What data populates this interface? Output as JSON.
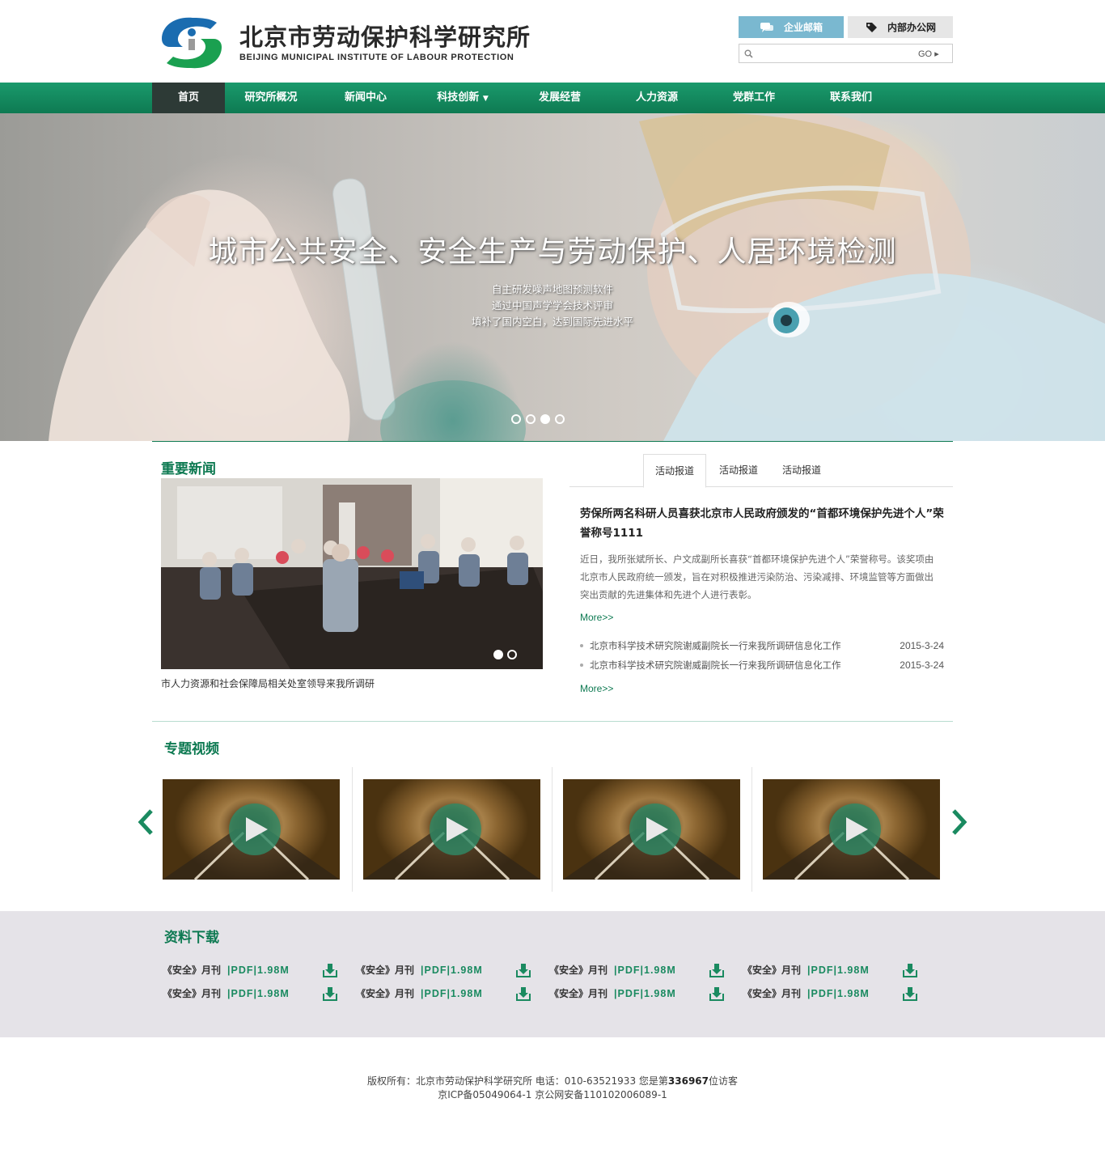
{
  "header": {
    "logo_cn": "北京市劳动保护科学研究所",
    "logo_en": "BEIJING MUNICIPAL INSTITUTE OF LABOUR PROTECTION",
    "mail_label": "企业邮箱",
    "office_label": "内部办公网",
    "search_placeholder": "",
    "search_go": "GO"
  },
  "nav": {
    "items": [
      {
        "label": "首页"
      },
      {
        "label": "研究所概况"
      },
      {
        "label": "新闻中心"
      },
      {
        "label": "科技创新"
      },
      {
        "label": "发展经营"
      },
      {
        "label": "人力资源"
      },
      {
        "label": "党群工作"
      },
      {
        "label": "联系我们"
      }
    ]
  },
  "banner": {
    "title": "城市公共安全、安全生产与劳动保护、人居环境检测",
    "lines": [
      "自主研发噪声地图预测软件",
      "通过中国声学学会技术评审",
      "填补了国内空白，达到国际先进水平"
    ],
    "active_slide": 3,
    "slide_count": 4
  },
  "news": {
    "title": "重要新闻",
    "photo_caption": "市人力资源和社会保障局相关处室领导来我所调研",
    "tabs": [
      {
        "label": "活动报道"
      },
      {
        "label": "活动报道"
      },
      {
        "label": "活动报道"
      }
    ],
    "headline": "劳保所两名科研人员喜获北京市人民政府颁发的“首都环境保护先进个人”荣誉称号1111",
    "summary": "近日，我所张斌所长、户文成副所长喜获“首都环境保护先进个人”荣誉称号。该奖项由北京市人民政府统一颁发，旨在对积极推进污染防治、污染减排、环境监管等方面做出突出贡献的先进集体和先进个人进行表彰。",
    "more": "More>>",
    "list": [
      {
        "title": "北京市科学技术研究院谢威副院长一行来我所调研信息化工作",
        "date": "2015-3-24"
      },
      {
        "title": "北京市科学技术研究院谢威副院长一行来我所调研信息化工作",
        "date": "2015-3-24"
      }
    ]
  },
  "video": {
    "title": "专题视频",
    "count": 4
  },
  "downloads": {
    "title": "资料下载",
    "rows": [
      [
        {
          "name": "《安全》月刊",
          "meta": "|PDF|1.98M"
        },
        {
          "name": "《安全》月刊",
          "meta": "|PDF|1.98M"
        },
        {
          "name": "《安全》月刊",
          "meta": "|PDF|1.98M"
        },
        {
          "name": "《安全》月刊",
          "meta": "|PDF|1.98M"
        }
      ],
      [
        {
          "name": "《安全》月刊",
          "meta": "|PDF|1.98M"
        },
        {
          "name": "《安全》月刊",
          "meta": "|PDF|1.98M"
        },
        {
          "name": "《安全》月刊",
          "meta": "|PDF|1.98M"
        },
        {
          "name": "《安全》月刊",
          "meta": "|PDF|1.98M"
        }
      ]
    ]
  },
  "footer": {
    "line1_prefix": "版权所有：北京市劳动保护科学研究所 电话：010-63521933 您是第",
    "visitor_count": "336967",
    "line1_suffix": "位访客",
    "line2": "京ICP备05049064-1 京公网安备110102006089-1"
  },
  "colors": {
    "brand_green": "#0e7a52",
    "mail_blue": "#7ab8d0",
    "download_bg": "#e5e3e8"
  }
}
